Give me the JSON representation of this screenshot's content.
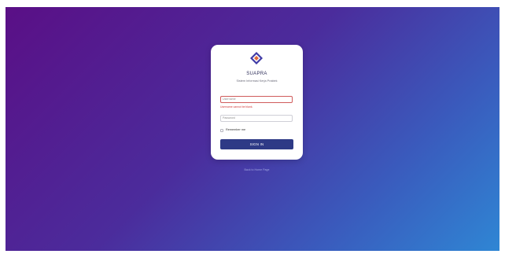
{
  "login": {
    "app_title": "SUAPRA",
    "subtitle": "Sistem Informasi Kerja Praktek",
    "username": {
      "placeholder": "Username",
      "error": "Username cannot be blank."
    },
    "password": {
      "placeholder": "Password"
    },
    "remember_label": "Remember me",
    "sign_in_label": "SIGN IN",
    "back_link": "Back to Home Page"
  },
  "colors": {
    "background_gradient_start": "#5a0f86",
    "background_gradient_end": "#2f86d4",
    "button": "#2e3a86",
    "error": "#d23a3a"
  },
  "icons": {
    "logo": "suapra-diamond-logo-icon"
  }
}
